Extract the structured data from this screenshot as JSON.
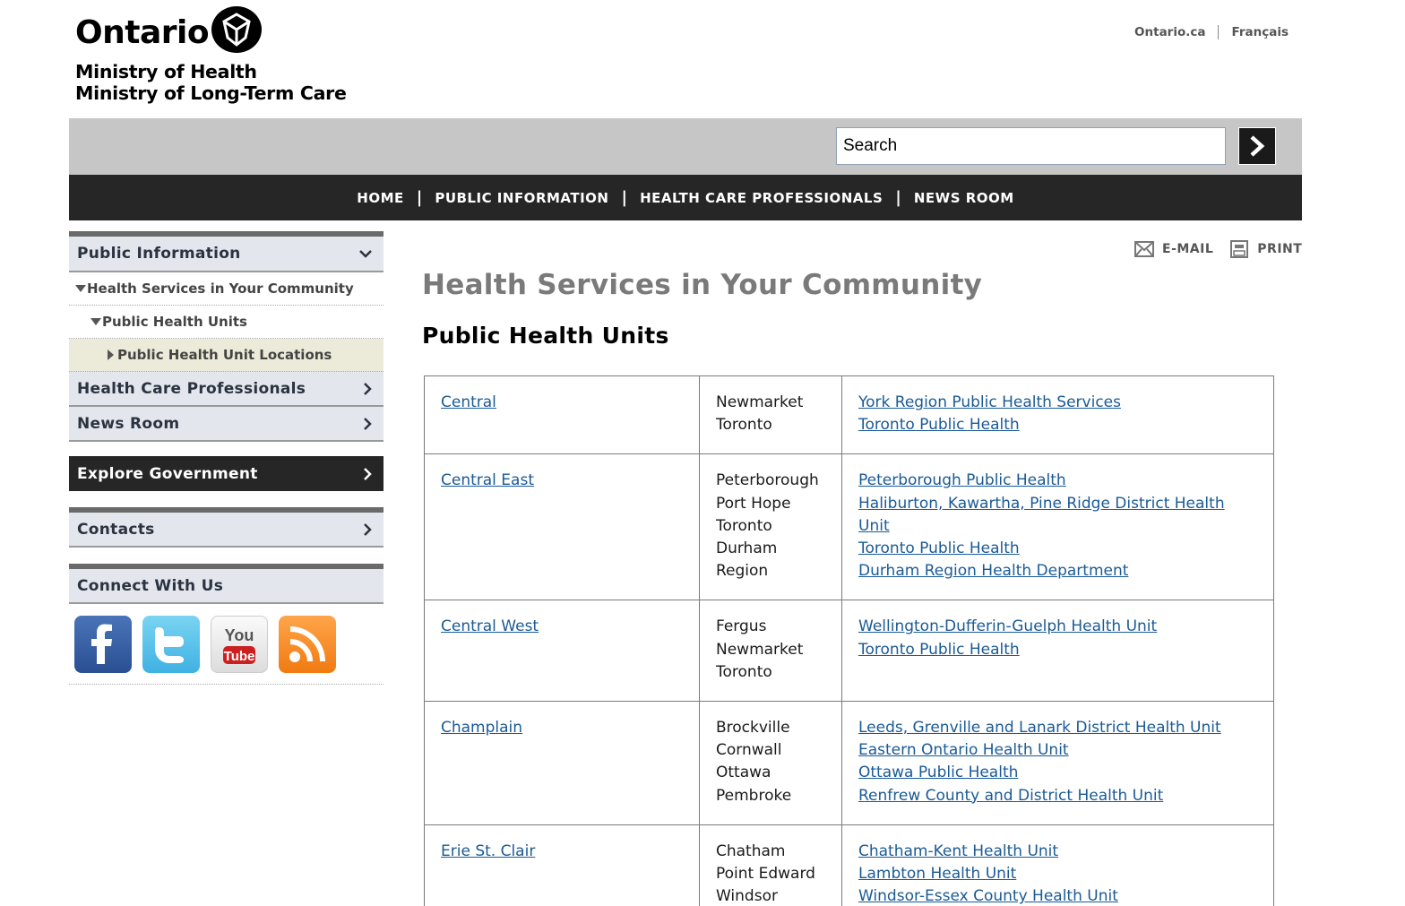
{
  "header": {
    "logo_text": "Ontario",
    "ministry_line1": "Ministry of Health",
    "ministry_line2": "Ministry of Long-Term Care",
    "top_links": [
      "Ontario.ca",
      "Français"
    ]
  },
  "search": {
    "value": "Search",
    "button_icon": "chevron-right-icon"
  },
  "nav": {
    "items": [
      "HOME",
      "PUBLIC INFORMATION",
      "HEALTH CARE PROFESSIONALS",
      "NEWS ROOM"
    ]
  },
  "sidebar": {
    "public_information": "Public Information",
    "sub1": "Health Services in Your Community",
    "sub2": "Public Health Units",
    "sub3": "Public Health Unit Locations",
    "health_care_professionals": "Health Care Professionals",
    "news_room": "News Room",
    "explore_government": "Explore Government",
    "contacts": "Contacts",
    "connect_with_us": "Connect With Us",
    "social": [
      "facebook-icon",
      "twitter-icon",
      "youtube-icon",
      "rss-icon"
    ]
  },
  "tools": {
    "email": "E-MAIL",
    "print": "PRINT"
  },
  "main": {
    "page_title": "Health Services in Your Community",
    "section_title": "Public Health Units"
  },
  "table": {
    "rows": [
      {
        "region": "Central",
        "cities": [
          "Newmarket",
          "Toronto"
        ],
        "units": [
          "York Region Public Health Services",
          "Toronto Public Health"
        ]
      },
      {
        "region": "Central East",
        "cities": [
          "Peterborough",
          "Port Hope",
          "Toronto",
          "Durham",
          "Region"
        ],
        "units": [
          "Peterborough Public Health",
          "Haliburton, Kawartha, Pine Ridge District Health Unit",
          "Toronto Public Health",
          "Durham Region Health Department"
        ]
      },
      {
        "region": "Central West",
        "cities": [
          "Fergus",
          "Newmarket",
          "Toronto"
        ],
        "units": [
          "Wellington-Dufferin-Guelph Health Unit",
          "Toronto Public Health"
        ]
      },
      {
        "region": "Champlain",
        "cities": [
          "Brockville",
          "Cornwall",
          "Ottawa",
          "Pembroke"
        ],
        "units": [
          "Leeds, Grenville and Lanark District Health Unit",
          "Eastern Ontario Health Unit",
          "Ottawa Public Health",
          "Renfrew County and District Health Unit"
        ]
      },
      {
        "region": "Erie St. Clair",
        "cities": [
          "Chatham",
          "Point Edward",
          "Windsor"
        ],
        "units": [
          "Chatham-Kent Health Unit",
          "Lambton Health Unit",
          "Windsor-Essex County Health Unit"
        ]
      }
    ]
  },
  "colors": {
    "link": "#1a5a96",
    "nav_bg": "#262626",
    "search_bar_bg": "#c6c6c6",
    "sidebar_item_bg": "#e3e6ec",
    "active_item_bg": "#ecebd9"
  }
}
